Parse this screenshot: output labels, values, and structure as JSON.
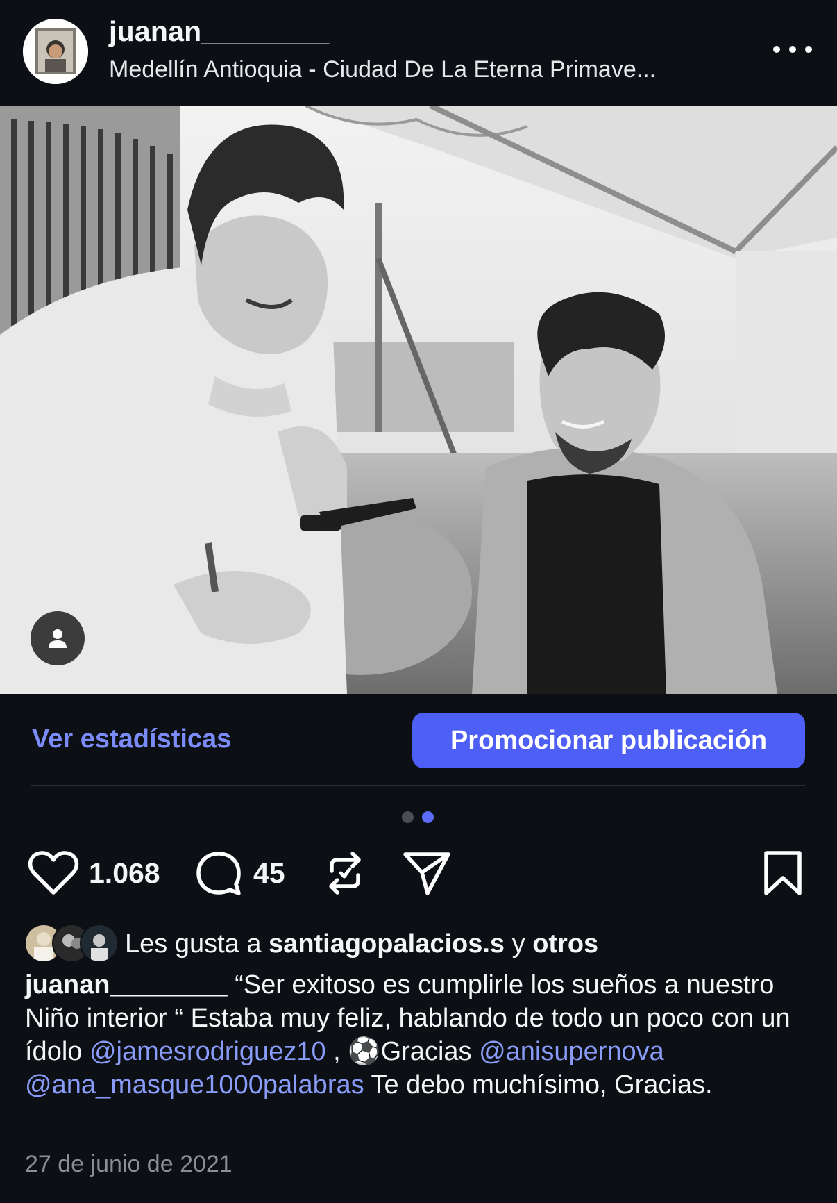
{
  "post": {
    "username": "juanan________",
    "location": "Medellín Antioquia - Ciudad De La Eterna Primave...",
    "more_icon": "more-horizontal-icon"
  },
  "media": {
    "tag_icon": "person-tag-icon",
    "carousel": {
      "count": 2,
      "active_index": 1
    }
  },
  "actions": {
    "insights_label": "Ver estadísticas",
    "promote_label": "Promocionar publicación"
  },
  "engagement": {
    "like_count": "1.068",
    "comment_count": "45",
    "icons": [
      "heart-icon",
      "comment-icon",
      "repost-icon",
      "send-icon",
      "bookmark-icon"
    ]
  },
  "likes": {
    "prefix": "Les gusta a",
    "user": "santiagopalacios.s",
    "connector": "y",
    "others": "otros"
  },
  "caption": {
    "author": "juanan________",
    "text_1": " “Ser exitoso es cumplirle los sueños a nuestro Niño interior “ Estaba muy feliz, hablando de todo un poco con un ídolo ",
    "mention_1": "@jamesrodriguez10",
    "text_2": " , ⚽Gracias ",
    "mention_2": "@anisupernova",
    "text_3": " ",
    "mention_3": "@ana_masque1000palabras",
    "text_4": " Te debo muchísimo, Gracias."
  },
  "date": "27 de junio de 2021",
  "colors": {
    "background": "#0c0f14",
    "accent": "#4e5ff5",
    "link": "#7b8cf8",
    "mention": "#8a9cf9",
    "muted": "#8b8e95"
  }
}
